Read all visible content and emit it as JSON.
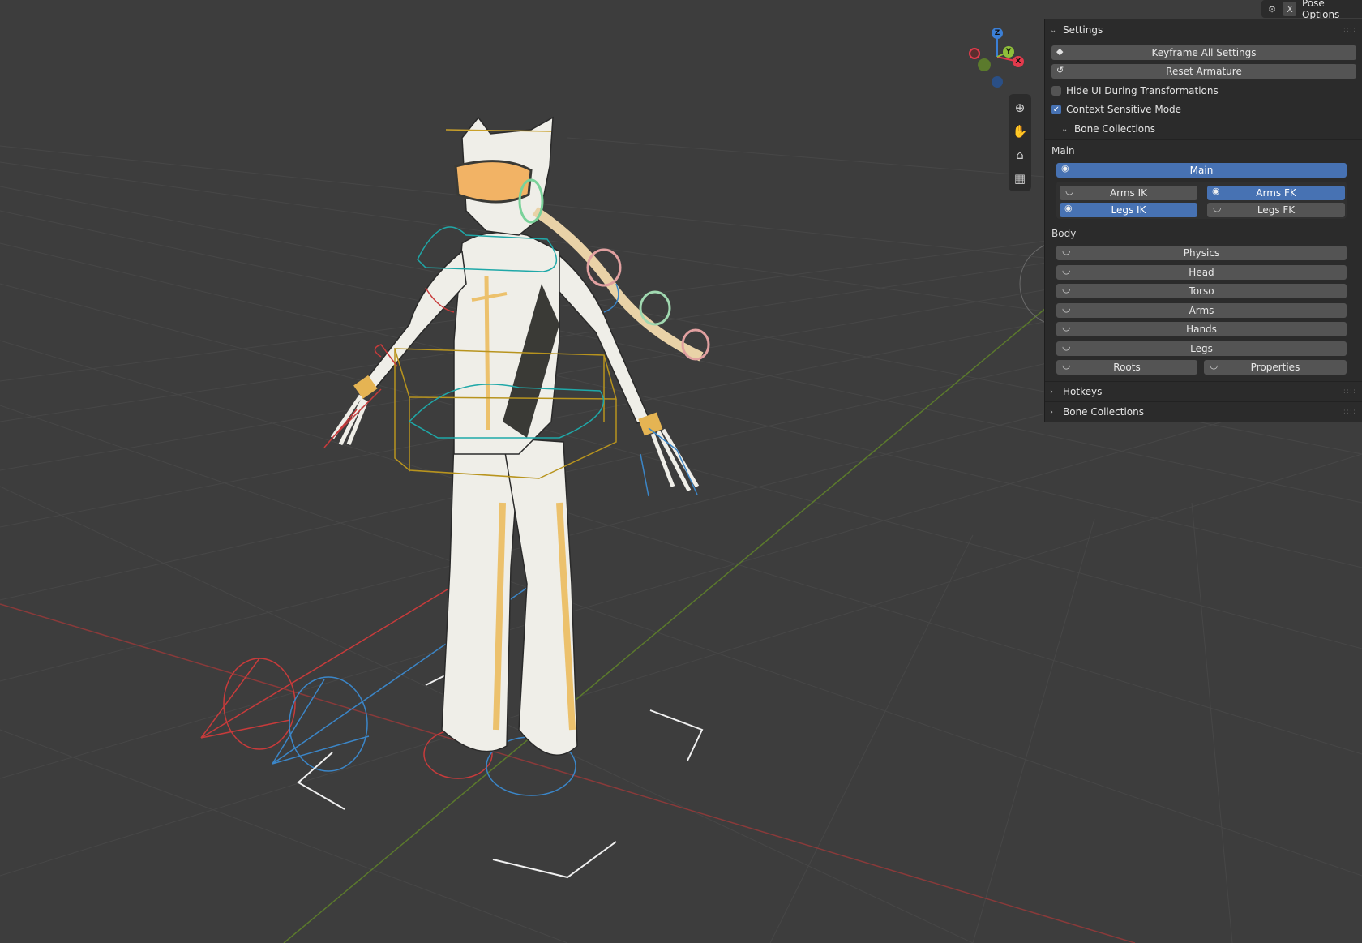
{
  "header": {
    "close_glyph": "X",
    "panel_title": "Pose Options"
  },
  "gizmo": {
    "z": "Z",
    "y": "Y",
    "x": "X"
  },
  "navtools": [
    {
      "icon": "zoom-icon",
      "glyph": "🔍"
    },
    {
      "icon": "hand-icon",
      "glyph": "✋"
    },
    {
      "icon": "camera-icon",
      "glyph": "🎥"
    },
    {
      "icon": "grid-icon",
      "glyph": "▦"
    }
  ],
  "panel": {
    "settings_label": "Settings",
    "keyframe_label": "Keyframe All Settings",
    "reset_label": "Reset Armature",
    "hide_ui_label": "Hide UI During Transformations",
    "hide_ui_checked": false,
    "context_label": "Context Sensitive Mode",
    "context_checked": true,
    "bone_collections_sub": "Bone Collections",
    "main_group_label": "Main",
    "body_group_label": "Body",
    "main_buttons": {
      "main": {
        "label": "Main",
        "visible": true
      },
      "arms_ik": {
        "label": "Arms IK",
        "visible": false
      },
      "arms_fk": {
        "label": "Arms FK",
        "visible": true
      },
      "legs_ik": {
        "label": "Legs IK",
        "visible": true
      },
      "legs_fk": {
        "label": "Legs FK",
        "visible": false
      }
    },
    "body_buttons": {
      "physics": {
        "label": "Physics",
        "visible": false
      },
      "head": {
        "label": "Head",
        "visible": false
      },
      "torso": {
        "label": "Torso",
        "visible": false
      },
      "arms": {
        "label": "Arms",
        "visible": false
      },
      "hands": {
        "label": "Hands",
        "visible": false
      },
      "legs": {
        "label": "Legs",
        "visible": false
      },
      "roots": {
        "label": "Roots",
        "visible": false
      },
      "properties": {
        "label": "Properties",
        "visible": false
      }
    },
    "hotkeys_label": "Hotkeys",
    "bone_collections_label": "Bone Collections"
  },
  "colors": {
    "accent": "#4772b3",
    "bg": "#3d3d3d",
    "panel": "#2b2b2b",
    "x_axis": "#e33a4c",
    "y_axis": "#8fbf3a",
    "z_axis": "#3b7fd6"
  }
}
